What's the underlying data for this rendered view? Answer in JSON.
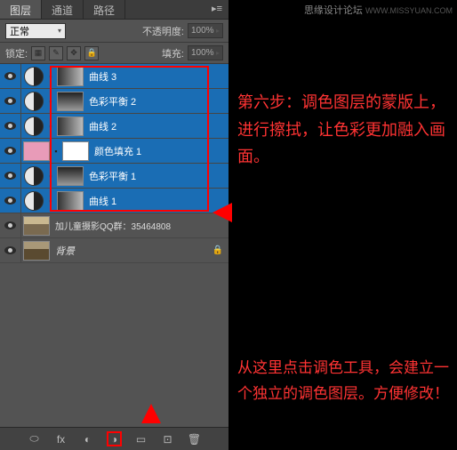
{
  "tabs": {
    "layers": "图层",
    "channels": "通道",
    "paths": "路径"
  },
  "blend_mode": "正常",
  "opacity_label": "不透明度:",
  "opacity_value": "100%",
  "lock_label": "锁定:",
  "fill_label": "填充:",
  "fill_value": "100%",
  "layers": [
    {
      "name": "曲线 3"
    },
    {
      "name": "色彩平衡 2"
    },
    {
      "name": "曲线 2"
    },
    {
      "name": "颜色填充 1"
    },
    {
      "name": "色彩平衡 1"
    },
    {
      "name": "曲线 1"
    }
  ],
  "group_layer": "加儿童摄影QQ群：35464808",
  "bg_layer": "背景",
  "annot1": "第六步：调色图层的蒙版上，进行擦拭，让色彩更加融入画面。",
  "annot2": "从这里点击调色工具，会建立一个独立的调色图层。方便修改！",
  "watermark": "思缘设计论坛",
  "watermark_url": "WWW.MISSYUAN.COM"
}
